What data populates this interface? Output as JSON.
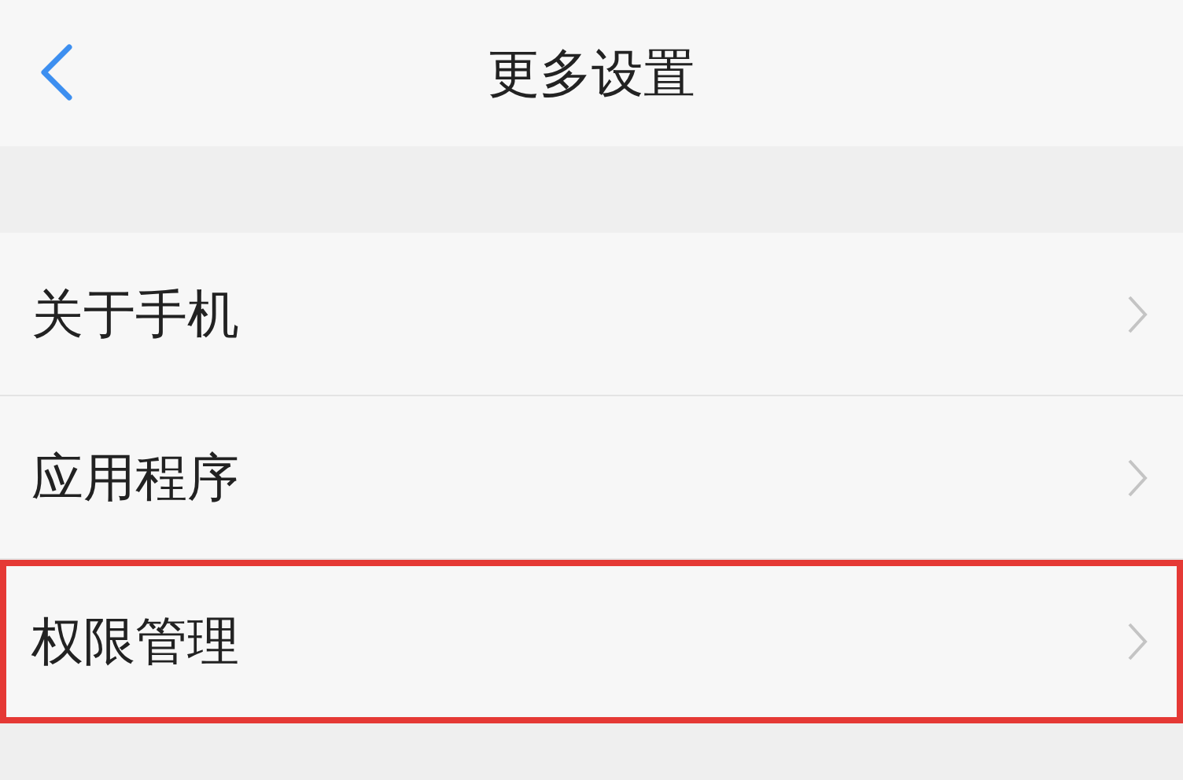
{
  "header": {
    "title": "更多设置"
  },
  "items": [
    {
      "label": "关于手机",
      "highlighted": false
    },
    {
      "label": "应用程序",
      "highlighted": false
    },
    {
      "label": "权限管理",
      "highlighted": true
    }
  ]
}
